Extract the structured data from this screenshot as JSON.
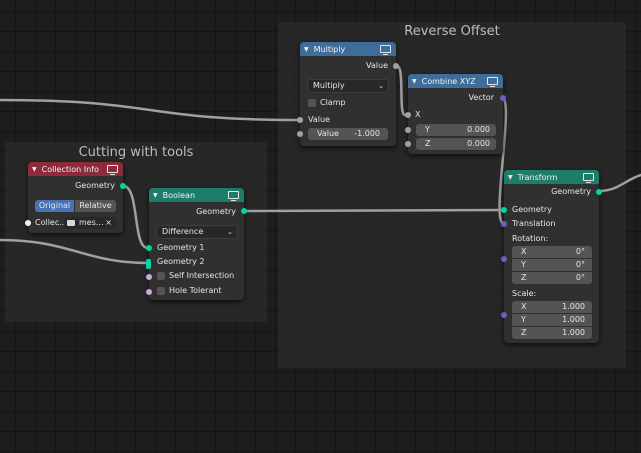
{
  "frames": {
    "reverse_offset": {
      "label": "Reverse Offset"
    },
    "cutting": {
      "label": "Cutting with tools"
    }
  },
  "nodes": {
    "multiply": {
      "title": "Multiply",
      "out_value": "Value",
      "operation": "Multiply",
      "clamp": "Clamp",
      "in_value": "Value",
      "value_label": "Value",
      "value": "-1.000"
    },
    "combine": {
      "title": "Combine XYZ",
      "out_vector": "Vector",
      "x": "X",
      "y_label": "Y",
      "y_value": "0.000",
      "z_label": "Z",
      "z_value": "0.000"
    },
    "collection": {
      "title": "Collection Info",
      "out_geometry": "Geometry",
      "btn_original": "Original",
      "btn_relative": "Relative",
      "collection_label": "Collec...",
      "collection_value": "mes...",
      "clear": "×"
    },
    "boolean": {
      "title": "Boolean",
      "out_geometry": "Geometry",
      "operation": "Difference",
      "geometry1": "Geometry 1",
      "geometry2": "Geometry 2",
      "self_intersection": "Self Intersection",
      "hole_tolerant": "Hole Tolerant"
    },
    "transform": {
      "title": "Transform",
      "out_geometry": "Geometry",
      "in_geometry": "Geometry",
      "translation": "Translation",
      "rotation": "Rotation:",
      "rx": "X",
      "rx_val": "0°",
      "ry": "Y",
      "ry_val": "0°",
      "rz": "Z",
      "rz_val": "0°",
      "scale": "Scale:",
      "sx": "X",
      "sx_val": "1.000",
      "sy": "Y",
      "sy_val": "1.000",
      "sz": "Z",
      "sz_val": "1.000"
    }
  },
  "colors": {
    "background": "#1d1d1d",
    "frame": "#282828",
    "node_body": "#303030",
    "header_input": "#8b2b3b",
    "header_converter": "#3e6d99",
    "header_geometry": "#1d7d6a",
    "socket_geometry": "#00d6a3",
    "socket_value": "#a1a1a1",
    "socket_vector": "#6363c7",
    "socket_boolean": "#cca6d6",
    "link": "#a0a0a0"
  }
}
